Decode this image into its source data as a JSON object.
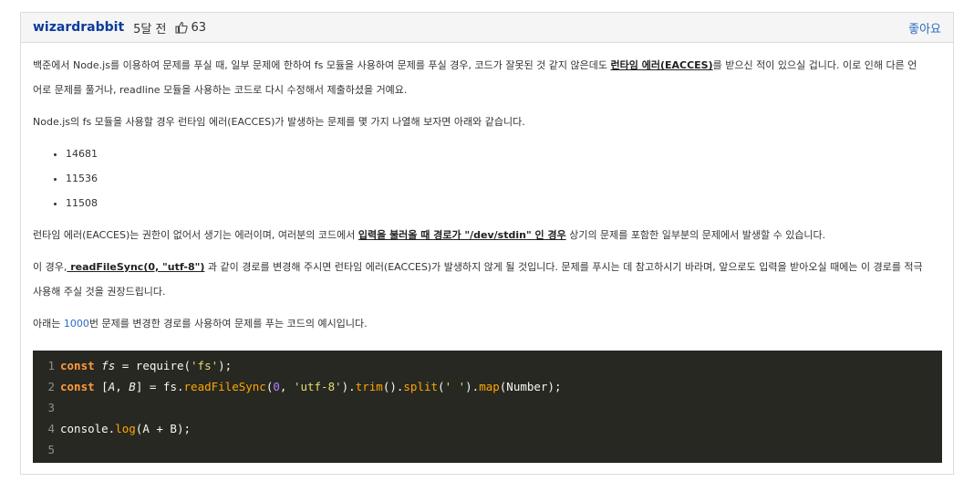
{
  "header": {
    "author": "wizardrabbit",
    "time": "5달 전",
    "likes": "63",
    "like_button": "좋아요"
  },
  "content": {
    "p1_a": "백준에서 Node.js를 이용하여 문제를 푸실 때, 일부 문제에 한하여 fs 모듈을 사용하여 문제를 푸실 경우, 코드가 잘못된 것 같지 않은데도 ",
    "p1_b": "런타임 에러(EACCES)",
    "p1_c": "를 받으신 적이 있으실 겁니다. 이로 인해 다른 언",
    "p1_d": "어로 문제를 풀거나, readline 모듈을 사용하는 코드로 다시 수정해서 제출하셨을 거예요.",
    "p2": "Node.js의 fs 모듈을 사용할 경우 런타임 에러(EACCES)가 발생하는 문제를 몇 가지 나열해 보자면 아래와 같습니다.",
    "list": [
      "14681",
      "11536",
      "11508"
    ],
    "p3_a": "런타임 에러(EACCES)는 권한이 없어서 생기는 에러이며, 여러분의 코드에서 ",
    "p3_b": "입력을 불러올 때 경로가 \"/dev/stdin\" 인 경우",
    "p3_c": " 상기의 문제를 포함한 일부분의 문제에서 발생할 수 있습니다.",
    "p4_a": "이 경우,",
    "p4_b": " readFileSync(0, \"utf-8\")",
    "p4_c": " 과 같이 경로를 변경해 주시면 런타임 에러(EACCES)가 발생하지 않게 될 것입니다. 문제를 푸시는 데 참고하시기 바라며, 앞으로도 입력을 받아오실 때에는 이 경로를 적극",
    "p4_d": "사용해 주실 것을 권장드립니다.",
    "p5_a": "아래는 ",
    "p5_link": "1000",
    "p5_b": "번 문제를 변경한 경로를 사용하여 문제를 푸는 코드의 예시입니다."
  },
  "code": {
    "line_numbers": [
      "1",
      "2",
      "3",
      "4",
      "5"
    ],
    "l1": {
      "kw": "const",
      "var": "fs",
      "op": " = require(",
      "str": "'fs'",
      "end": ");"
    },
    "l2": {
      "kw": "const",
      "open": " [",
      "a": "A",
      "comma": ", ",
      "b": "B",
      "mid": "] = fs.",
      "fn1": "readFileSync",
      "p1": "(",
      "n": "0",
      "c2": ", ",
      "s1": "'utf-8'",
      "p2": ").",
      "fn2": "trim",
      "p3": "().",
      "fn3": "split",
      "p4": "(",
      "s2": "' '",
      "p5": ").",
      "fn4": "map",
      "end": "(Number);"
    },
    "l4": {
      "pre": "console.",
      "fn": "log",
      "end": "(A + B);"
    }
  }
}
